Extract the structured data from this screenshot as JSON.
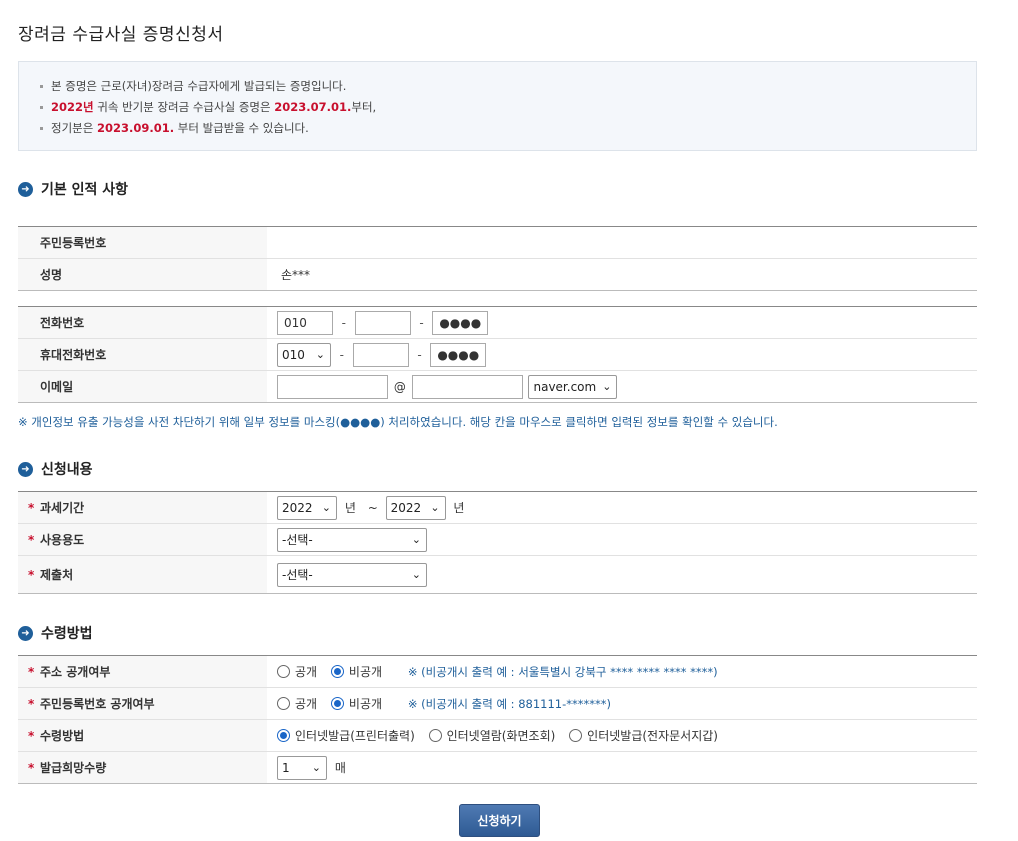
{
  "title": "장려금 수급사실 증명신청서",
  "notice": {
    "line1": "본 증명은 근로(자녀)장려금 수급자에게 발급되는 증명입니다.",
    "line2_year": "2022년",
    "line2_mid": " 귀속 반기분 장려금 수급사실 증명은 ",
    "line2_date": "2023.07.01.",
    "line2_end": "부터,",
    "line3_pre": "정기분은 ",
    "line3_date": "2023.09.01.",
    "line3_end": " 부터 발급받을 수 있습니다."
  },
  "sections": {
    "basic": "기본 인적 사항",
    "apply": "신청내용",
    "receive": "수령방법"
  },
  "basic": {
    "rrn_label": "주민등록번호",
    "rrn_value": "",
    "name_label": "성명",
    "name_value": "손***"
  },
  "contact": {
    "phone_label": "전화번호",
    "phone1": "010",
    "phone2": "",
    "phone3": "●●●●",
    "mobile_label": "휴대전화번호",
    "mobile1": "010",
    "mobile2": "",
    "mobile3": "●●●●",
    "dash": "-",
    "email_label": "이메일",
    "email_id": "",
    "at": "@",
    "email_domain": "",
    "email_select": "naver.com"
  },
  "mask_note": "※ 개인정보 유출 가능성을 사전 차단하기 위해 일부 정보를 마스킹(●●●●) 처리하였습니다. 해당 칸을 마우스로 클릭하면 입력된 정보를 확인할 수 있습니다.",
  "apply": {
    "required_mark": "*",
    "period_label": "과세기간",
    "year_from": "2022",
    "year_unit": "년",
    "tilde": "~",
    "year_to": "2022",
    "purpose_label": "사용용도",
    "purpose_value": "-선택-",
    "submit_to_label": "제출처",
    "submit_to_value": "-선택-"
  },
  "receive": {
    "addr_label": "주소 공개여부",
    "addr_opt_public": "공개",
    "addr_opt_private": "비공개",
    "addr_note": "※ (비공개시 출력 예 : 서울특별시 강북구 **** **** **** ****)",
    "rrn_label": "주민등록번호 공개여부",
    "rrn_opt_public": "공개",
    "rrn_opt_private": "비공개",
    "rrn_note": "※ (비공개시 출력 예 : 881111-*******)",
    "method_label": "수령방법",
    "method_opt1": "인터넷발급(프린터출력)",
    "method_opt2": "인터넷열람(화면조회)",
    "method_opt3": "인터넷발급(전자문서지갑)",
    "qty_label": "발급희망수량",
    "qty_value": "1",
    "qty_unit": "매"
  },
  "submit_label": "신청하기",
  "icons": {
    "section": "arrow-circle-icon",
    "select": "chevron-down-icon",
    "accent": "#1f5f9a",
    "red": "#c8102e"
  }
}
